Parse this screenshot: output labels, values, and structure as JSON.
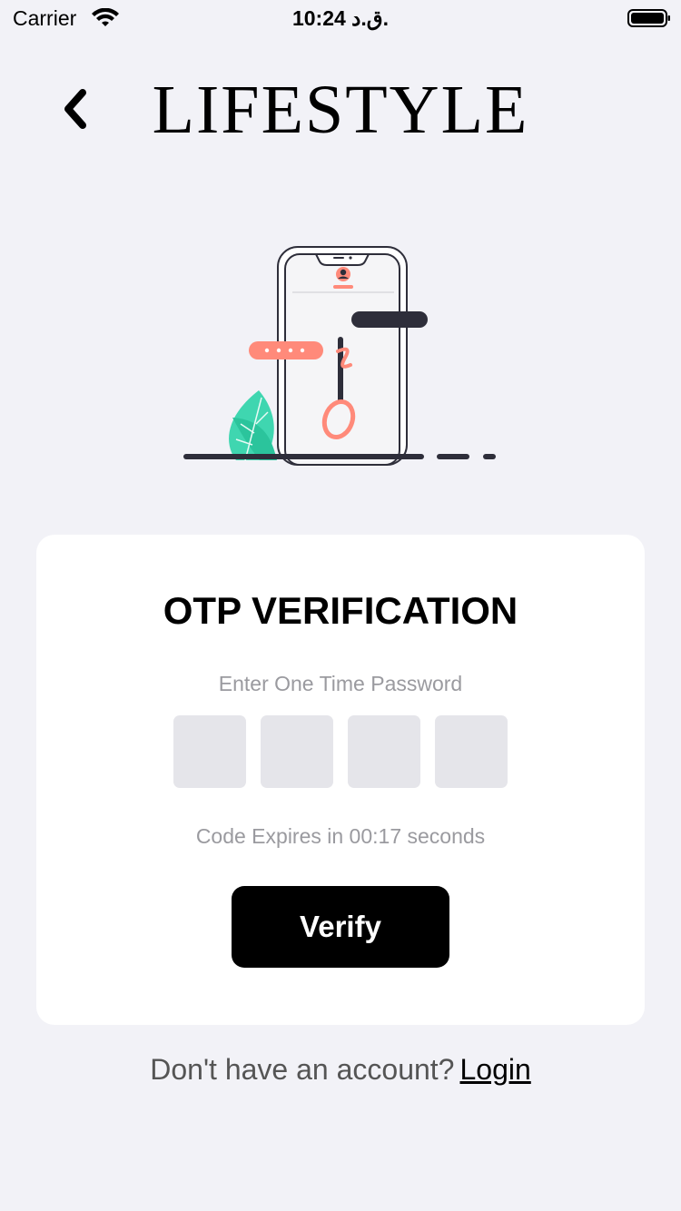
{
  "status_bar": {
    "carrier": "Carrier",
    "time": "10:24 ق.د."
  },
  "header": {
    "title": "LIFESTYLE",
    "back_icon": "chevron-left-icon"
  },
  "illustration": {
    "icon": "phone-otp-illustration",
    "colors": {
      "accent": "#ff8a7a",
      "dark": "#2e2e3a",
      "leaf": "#3fd6b0"
    }
  },
  "card": {
    "title": "OTP VERIFICATION",
    "subtitle": "Enter One Time Password",
    "otp_boxes": [
      "",
      "",
      "",
      ""
    ],
    "expiry_text": "Code Expires in 00:17 seconds",
    "verify_label": "Verify"
  },
  "footer": {
    "prompt": "Don't have an account?",
    "login_label": "Login"
  },
  "colors": {
    "background": "#f2f2f7",
    "card": "#ffffff",
    "button": "#000000",
    "muted_text": "#9a9a9f",
    "otp_box": "#e5e5ea"
  }
}
